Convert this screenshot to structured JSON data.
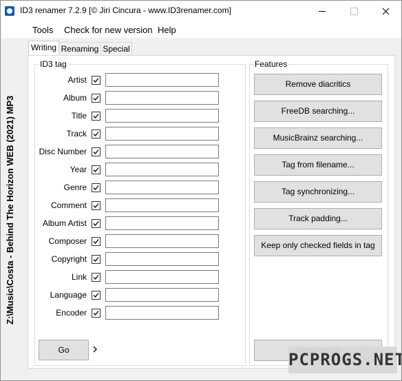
{
  "window": {
    "title": "ID3 renamer 7.2.9 [© Jiri Cincura - www.ID3renamer.com]"
  },
  "menu": [
    "Tools",
    "Check for new version",
    "Help"
  ],
  "side_path": "Z:\\Music\\Costa - Behind The Horizon WEB (2021) MP3",
  "tabs": [
    "Writing",
    "Renaming",
    "Special"
  ],
  "active_tab": "Writing",
  "id3": {
    "group_title": "ID3 tag",
    "fields": [
      {
        "label": "Artist",
        "checked": true,
        "value": ""
      },
      {
        "label": "Album",
        "checked": true,
        "value": ""
      },
      {
        "label": "Title",
        "checked": true,
        "value": ""
      },
      {
        "label": "Track",
        "checked": true,
        "value": ""
      },
      {
        "label": "Disc Number",
        "checked": true,
        "value": ""
      },
      {
        "label": "Year",
        "checked": true,
        "value": ""
      },
      {
        "label": "Genre",
        "checked": true,
        "value": ""
      },
      {
        "label": "Comment",
        "checked": true,
        "value": ""
      },
      {
        "label": "Album Artist",
        "checked": true,
        "value": ""
      },
      {
        "label": "Composer",
        "checked": true,
        "value": ""
      },
      {
        "label": "Copyright",
        "checked": true,
        "value": ""
      },
      {
        "label": "Link",
        "checked": true,
        "value": ""
      },
      {
        "label": "Language",
        "checked": true,
        "value": ""
      },
      {
        "label": "Encoder",
        "checked": true,
        "value": ""
      }
    ],
    "go_label": "Go"
  },
  "features": {
    "group_title": "Features",
    "buttons": [
      "Remove diacritics",
      "FreeDB searching...",
      "MusicBrainz searching...",
      "Tag from filename...",
      "Tag synchronizing...",
      "Track padding...",
      "Keep only checked fields in tag"
    ],
    "remove_tag_label": "Remove tag"
  },
  "watermark": "PCPROGS.NET",
  "colors": {
    "button_bg": "#e1e1e1",
    "panel_bg": "#ffffff",
    "window_bg": "#f0f0f0"
  }
}
